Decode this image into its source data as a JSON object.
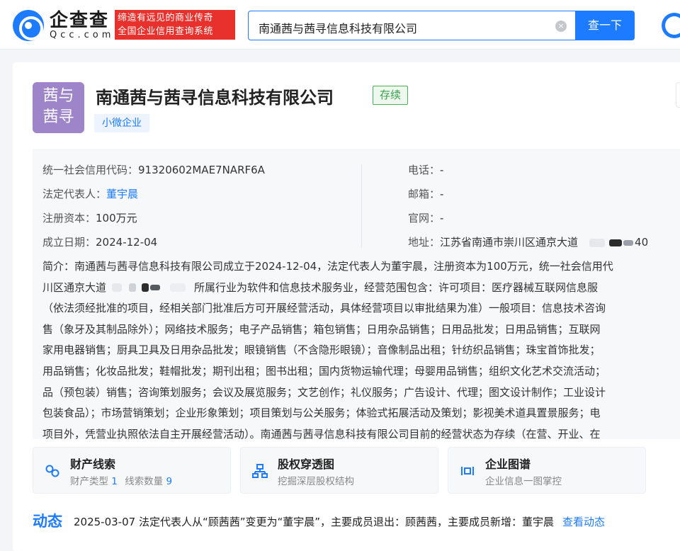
{
  "header": {
    "logo_cn": "企查查",
    "logo_en": "Qcc.com",
    "slogan_line1": "缔造有远见的商业传奇",
    "slogan_line2": "全国企业信用查询系统",
    "search_value": "南通茜与茜寻信息科技有限公司",
    "search_button": "查一下",
    "clear_icon": "×"
  },
  "company": {
    "logo_text_line1": "茜与",
    "logo_text_line2": "茜寻",
    "name": "南通茜与茜寻信息科技有限公司",
    "status": "存续",
    "tag": "小微企业"
  },
  "info": {
    "credit_code_label": "统一社会信用代码：",
    "credit_code": "91320602MAE7NARF6A",
    "legal_rep_label": "法定代表人：",
    "legal_rep": "董宇晨",
    "capital_label": "注册资本：",
    "capital": "100万元",
    "founded_label": "成立日期：",
    "founded": "2024-12-04",
    "phone_label": "电话：",
    "phone": "-",
    "email_label": "邮箱：",
    "email": "-",
    "website_label": "官网：",
    "website": "-",
    "address_label": "地址：",
    "address": "江苏省南通市崇川区通京大道",
    "address_tail": "40"
  },
  "intro_lines": [
    "简介：南通茜与茜寻信息科技有限公司成立于2024-12-04，法定代表人为董宇晨，注册资本为100万元，统一社会信用代",
    "所属行业为软件和信息技术服务业，经营范围包含：许可项目：医疗器械互联网信息服",
    "（依法须经批准的项目，经相关部门批准后方可开展经营活动，具体经营项目以审批结果为准）一般项目：信息技术咨询",
    "售（象牙及其制品除外）；网络技术服务；电子产品销售；箱包销售；日用杂品销售；日用品批发；日用品销售；互联网",
    "家用电器销售；厨具卫具及日用杂品批发；眼镜销售（不含隐形眼镜）；音像制品出租；针纺织品销售；珠宝首饰批发；",
    "用品销售；化妆品批发；鞋帽批发；期刊出租；图书出租；国内货物运输代理；母婴用品销售；组织文化艺术交流活动；",
    "品（预包装）销售；咨询策划服务；会议及展览服务；文艺创作；礼仪服务；广告设计、代理；图文设计制作；工业设计",
    "包装食品）；市场营销策划；企业形象策划；项目策划与公关服务；体验式拓展活动及策划；影视美术道具置景服务；电",
    "项目外，凭营业执照依法自主开展经营活动）。南通茜与茜寻信息科技有限公司目前的经营状态为存续（在营、开业、在"
  ],
  "intro_line2_prefix": "川区通京大道",
  "features": [
    {
      "title": "财产线索",
      "sub_a": "财产类型",
      "num_a": "1",
      "sub_b": "线索数量",
      "num_b": "9",
      "icon": "link-chain-icon"
    },
    {
      "title": "股权穿透图",
      "sub": "挖掘深层股权结构",
      "icon": "org-chart-icon"
    },
    {
      "title": "企业图谱",
      "sub": "企业信息一图掌控",
      "icon": "graph-icon"
    }
  ],
  "news": {
    "label": "动态",
    "text": "2025-03-07 法定代表人从“顾茜茜”变更为“董宇晨”，主要成员退出：顾茜茜，主要成员新增：董宇晨",
    "link": "查看动态"
  },
  "colors": {
    "accent": "#1c7bff",
    "slogan_bg": "#e8312c",
    "status_green": "#3aa050",
    "logo_purple": "#9e84c9"
  }
}
